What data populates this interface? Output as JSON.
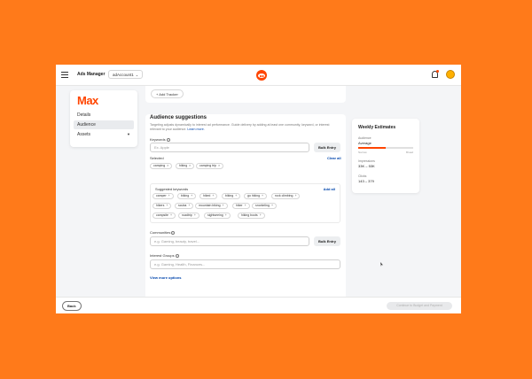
{
  "header": {
    "app_title": "Ads Manager",
    "account": "adAccount1",
    "logo": "reddit-logo-icon",
    "bell": "bell-icon",
    "avatar": "avatar-icon"
  },
  "sidebar": {
    "brand": "Max",
    "items": [
      {
        "label": "Details",
        "active": false
      },
      {
        "label": "Audience",
        "active": true
      },
      {
        "label": "Assets",
        "active": false
      }
    ]
  },
  "tracker": {
    "add_label": "+ Add Tracker"
  },
  "audience": {
    "title": "Audience suggestions",
    "description": "Targeting adjusts dynamically to interest ad performance. Guide delivery by adding at least one community, keyword, or interest relevant to your audience.",
    "learn_more": "Learn more.",
    "keywords_label": "Keywords",
    "keywords_placeholder": "Ex. Apple",
    "bulk_entry": "Bulk Entry",
    "selected_label": "Selected",
    "clear_all": "Clear all",
    "selected": [
      "camping",
      "hiking",
      "camping trip"
    ],
    "suggested_label": "Suggested keywords",
    "add_all": "Add all",
    "suggested": [
      [
        "camper",
        "biking",
        "hiked",
        "biking",
        "go hiking",
        "rock climbing"
      ],
      [
        "hikers",
        "scuba",
        "mountain biking",
        "hiker",
        "snorkeling"
      ],
      [
        "campsite",
        "roadtrip",
        "sightseeing",
        "hiking boots"
      ]
    ],
    "communities_label": "Communities",
    "communities_placeholder": "e.g. Gaming, beauty, travel...",
    "interest_label": "Interest Groups",
    "interest_placeholder": "e.g. Gaming, Health, Finances...",
    "view_more": "View more options"
  },
  "estimates": {
    "title": "Weekly Estimates",
    "audience_label": "Audience",
    "audience_value": "Average",
    "narrow_label": "Narrow",
    "broad_label": "Broad",
    "audience_level": 0.5,
    "impressions_label": "Impressions",
    "impressions_value": "33K – 53K",
    "clicks_label": "Clicks",
    "clicks_value": "143 – 379"
  },
  "footer": {
    "back": "Back",
    "continue": "Continue to Budget and Payment"
  },
  "colors": {
    "accent": "#FF4500",
    "background": "#FF7A1A",
    "link": "#0045AC"
  }
}
